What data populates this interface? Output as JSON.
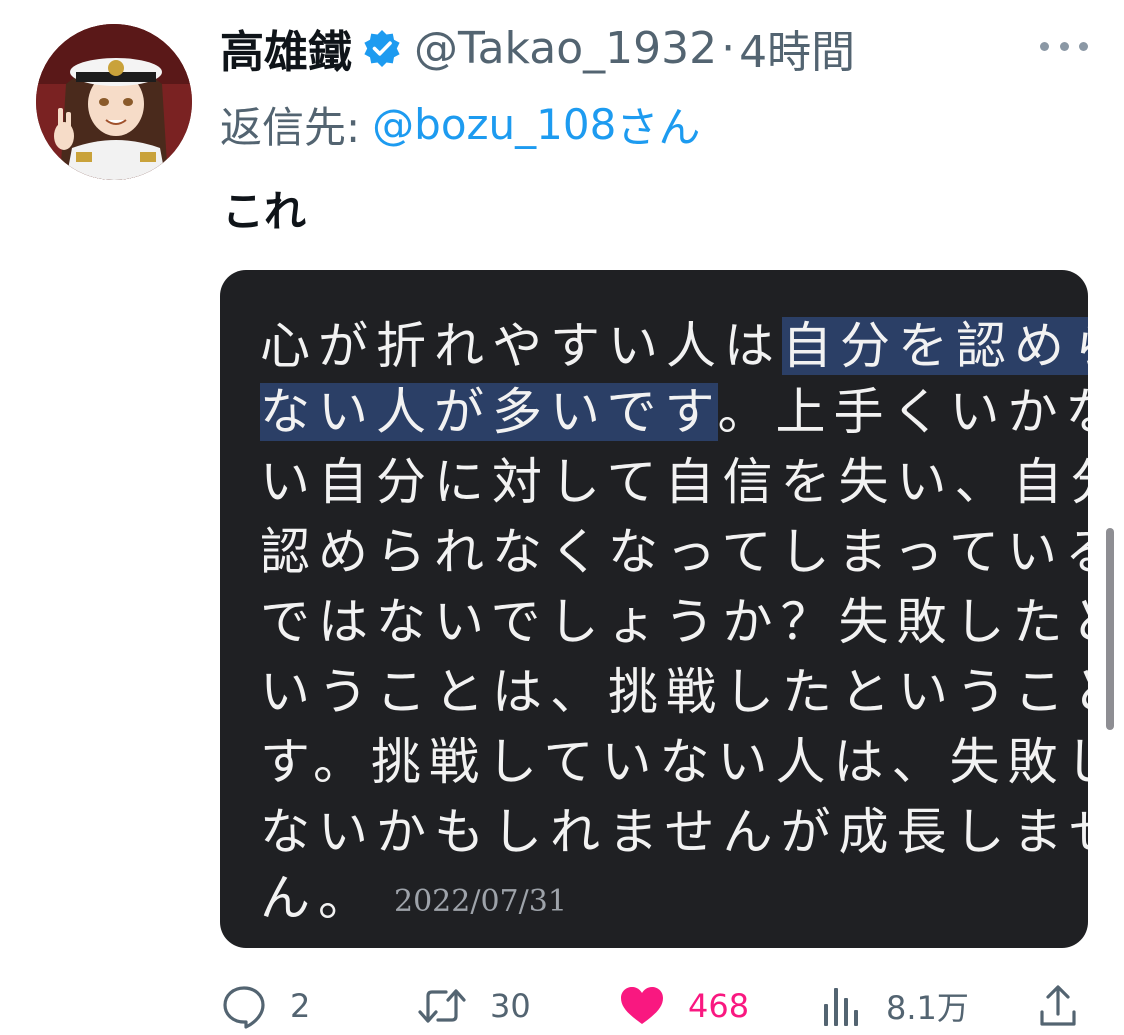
{
  "author": {
    "display_name": "高雄鐵",
    "handle": "@Takao_1932",
    "separator": "·",
    "time": "4時間"
  },
  "reply_to": {
    "label": "返信先:",
    "handle": "@bozu_108",
    "suffix": "さん"
  },
  "tweet": {
    "text": "これ"
  },
  "media": {
    "lines": [
      {
        "plain": "心が折れやすい人は",
        "highlight": "自分を認められ",
        "after": ""
      },
      {
        "plain": "",
        "highlight": "ない人が多いです",
        "after": "。上手くいかな"
      },
      {
        "plain": "い自分に対して自信を失い、自分を",
        "highlight": "",
        "after": ""
      },
      {
        "plain": "認められなくなってしまっているの",
        "highlight": "",
        "after": ""
      },
      {
        "plain": "ではないでしょうか？失敗したと",
        "highlight": "",
        "after": ""
      },
      {
        "plain": "いうことは、挑戦したということで",
        "highlight": "",
        "after": ""
      },
      {
        "plain": "す。挑戦していない人は、失敗し",
        "highlight": "",
        "after": ""
      },
      {
        "plain": "ないかもしれませんが成長しませ",
        "highlight": "",
        "after": ""
      },
      {
        "plain": "ん。",
        "highlight": "",
        "after": ""
      }
    ],
    "date": "2022/07/31"
  },
  "actions": {
    "replies": "2",
    "retweets": "30",
    "likes": "468",
    "views": "8.1万"
  },
  "icons": {
    "verified": "verified-badge-icon",
    "more": "more-dots-icon",
    "reply": "reply-bubble-icon",
    "retweet": "retweet-arrows-icon",
    "like": "heart-icon",
    "views": "views-bar-chart-icon",
    "share": "share-upload-icon"
  },
  "colors": {
    "link": "#1d9bf0",
    "secondary": "#536471",
    "like": "#f91880",
    "media_bg": "#1f2023",
    "highlight": "#2b3f66"
  }
}
